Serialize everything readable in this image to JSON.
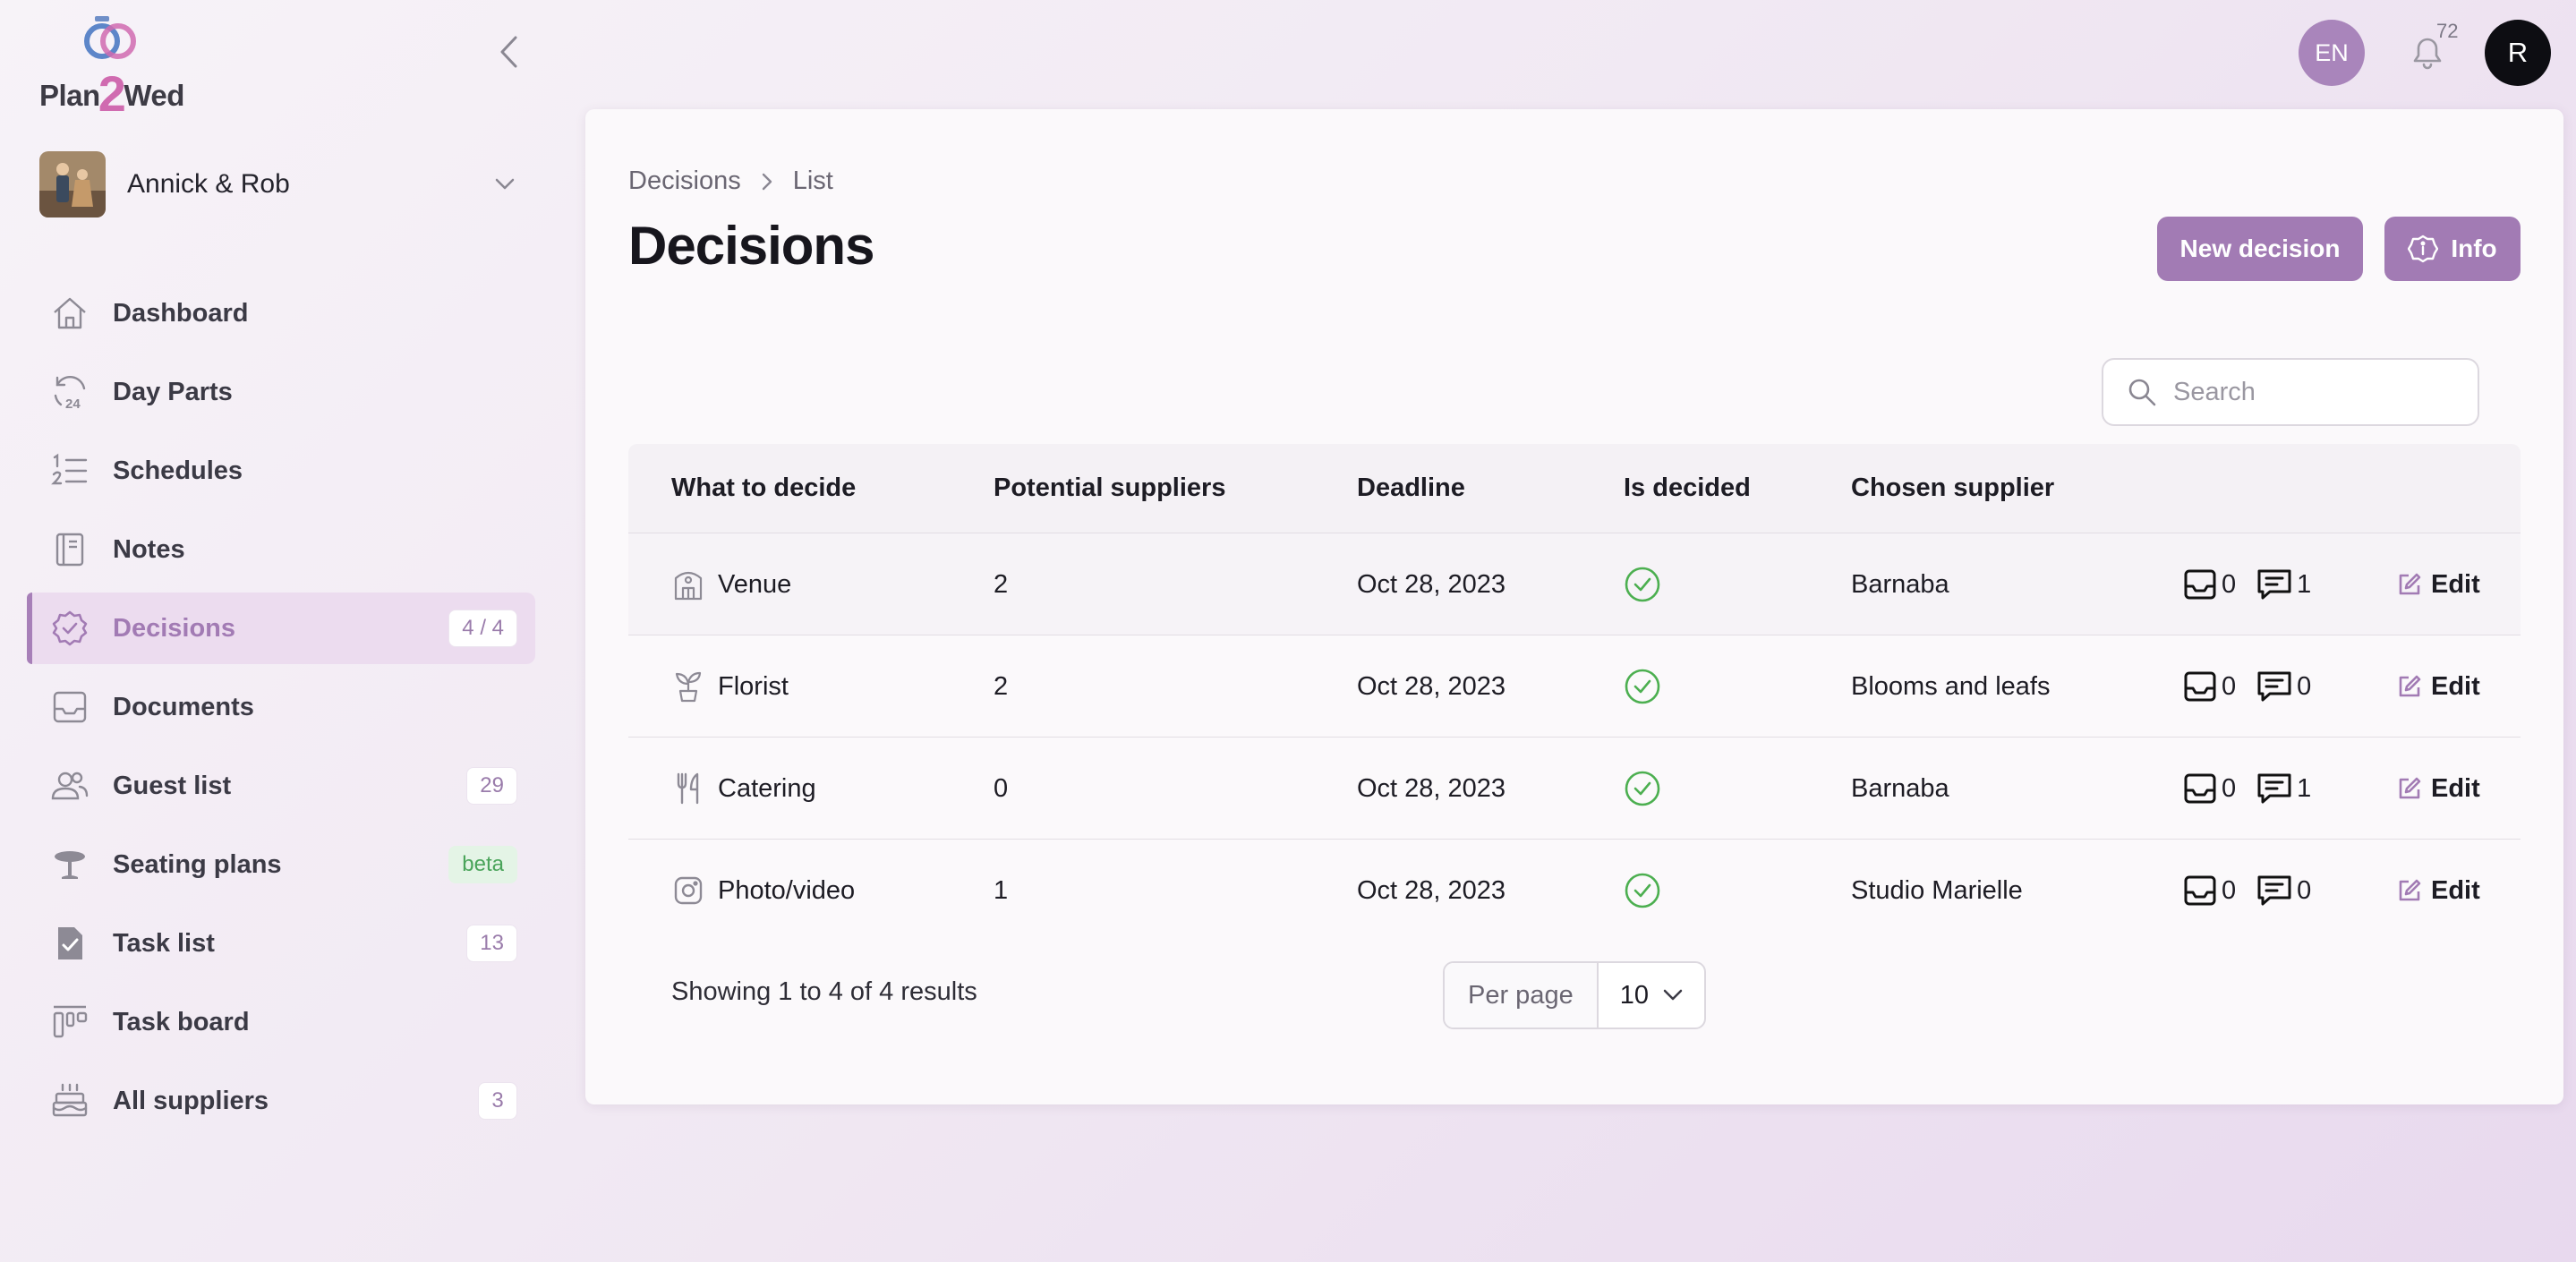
{
  "brand": {
    "name_left": "Plan",
    "name_mid": "2",
    "name_right": "Wed"
  },
  "couple": {
    "name": "Annick & Rob"
  },
  "sidebar": {
    "items": [
      {
        "label": "Dashboard",
        "icon": "home-icon",
        "badge": ""
      },
      {
        "label": "Day Parts",
        "icon": "clock-24-icon",
        "badge": ""
      },
      {
        "label": "Schedules",
        "icon": "numbered-list-icon",
        "badge": ""
      },
      {
        "label": "Notes",
        "icon": "notebook-icon",
        "badge": ""
      },
      {
        "label": "Decisions",
        "icon": "badge-check-icon",
        "badge": "4 / 4",
        "active": true
      },
      {
        "label": "Documents",
        "icon": "inbox-icon",
        "badge": ""
      },
      {
        "label": "Guest list",
        "icon": "users-icon",
        "badge": "29"
      },
      {
        "label": "Seating plans",
        "icon": "table-icon",
        "badge": "beta"
      },
      {
        "label": "Task list",
        "icon": "clipboard-check-icon",
        "badge": "13"
      },
      {
        "label": "Task board",
        "icon": "kanban-icon",
        "badge": ""
      },
      {
        "label": "All suppliers",
        "icon": "cake-icon",
        "badge": "3"
      }
    ]
  },
  "topbar": {
    "language": "EN",
    "notifications": "72",
    "user_initial": "R"
  },
  "breadcrumb": {
    "root": "Decisions",
    "current": "List"
  },
  "page": {
    "title": "Decisions",
    "new_button": "New decision",
    "info_button": "Info"
  },
  "search": {
    "placeholder": "Search"
  },
  "table": {
    "headers": {
      "what": "What to decide",
      "potential": "Potential suppliers",
      "deadline": "Deadline",
      "decided": "Is decided",
      "chosen": "Chosen supplier"
    },
    "rows": [
      {
        "what": "Venue",
        "icon": "building-icon",
        "potential": "2",
        "deadline": "Oct 28, 2023",
        "decided": true,
        "chosen": "Barnaba",
        "docs": "0",
        "comments": "1",
        "edit": "Edit"
      },
      {
        "what": "Florist",
        "icon": "plant-icon",
        "potential": "2",
        "deadline": "Oct 28, 2023",
        "decided": true,
        "chosen": "Blooms and leafs",
        "docs": "0",
        "comments": "0",
        "edit": "Edit"
      },
      {
        "what": "Catering",
        "icon": "cutlery-icon",
        "potential": "0",
        "deadline": "Oct 28, 2023",
        "decided": true,
        "chosen": "Barnaba",
        "docs": "0",
        "comments": "1",
        "edit": "Edit"
      },
      {
        "what": "Photo/video",
        "icon": "camera-icon",
        "potential": "1",
        "deadline": "Oct 28, 2023",
        "decided": true,
        "chosen": "Studio Marielle",
        "docs": "0",
        "comments": "0",
        "edit": "Edit"
      }
    ]
  },
  "pagination": {
    "summary": "Showing 1 to 4 of 4 results",
    "per_page_label": "Per page",
    "per_page_value": "10"
  },
  "colors": {
    "accent": "#a27bb4",
    "success": "#4caf50",
    "badge_beta": "#4aa45a"
  }
}
